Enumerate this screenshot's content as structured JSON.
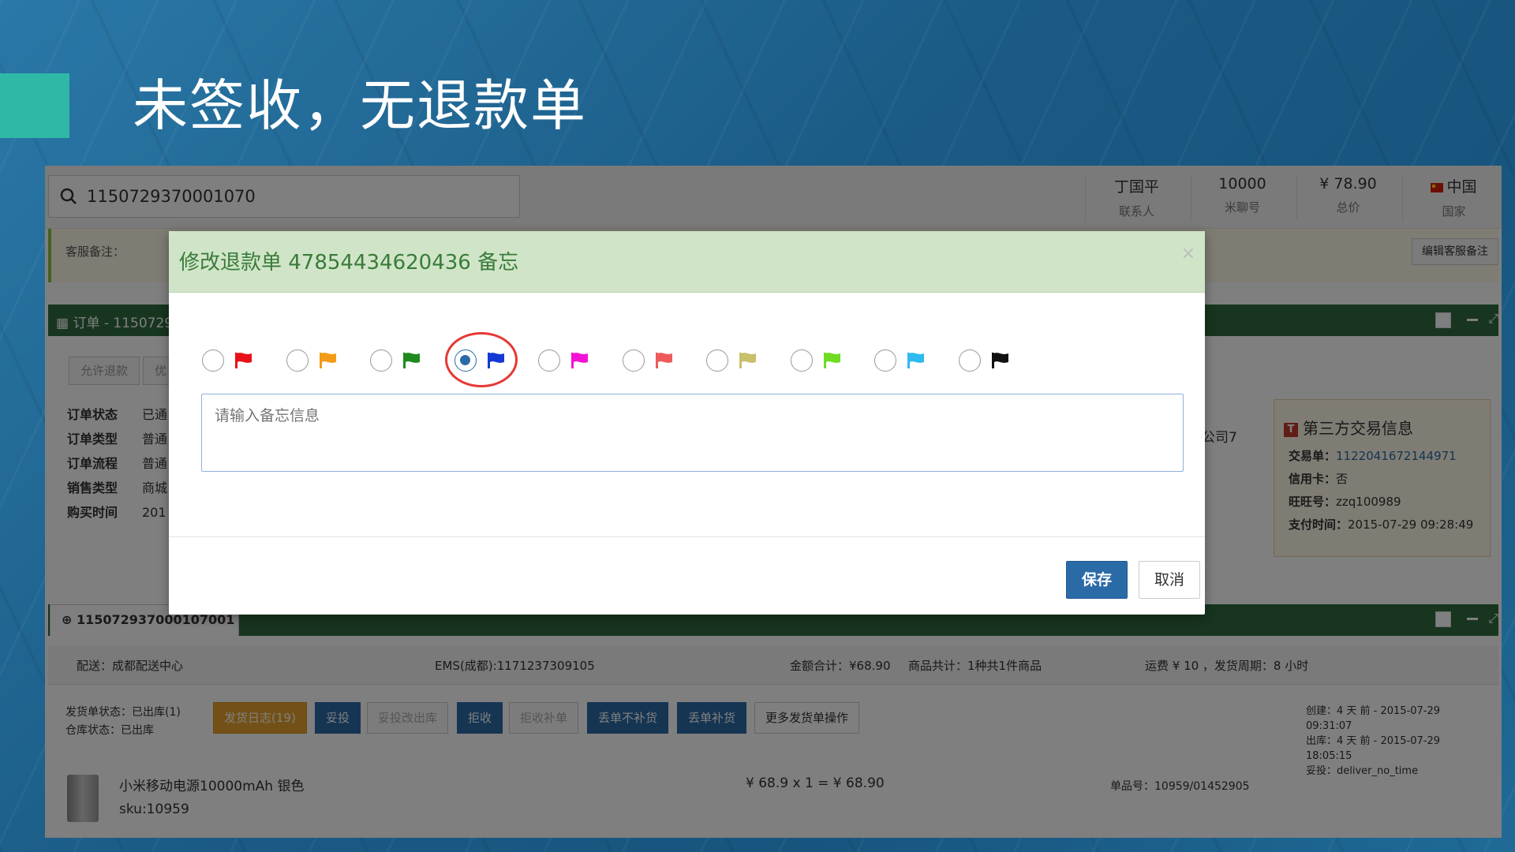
{
  "slide": {
    "title": "未签收，无退款单"
  },
  "app": {
    "search": {
      "value": "1150729370001070"
    },
    "stats": [
      {
        "value": "丁国平",
        "label": "联系人"
      },
      {
        "value": "10000",
        "label": "米聊号"
      },
      {
        "value": "¥ 78.90",
        "label": "总价"
      },
      {
        "value": "中国",
        "label": "国家"
      }
    ],
    "note_label": "客服备注：",
    "edit_note_button": "编辑客服备注",
    "order_panel_title": "订单 - 1150729",
    "buttons": {
      "allow_refund": "允许退款",
      "other": "优"
    },
    "order_info": [
      {
        "label": "订单状态",
        "value": "已通"
      },
      {
        "label": "订单类型",
        "value": "普通"
      },
      {
        "label": "订单流程",
        "value": "普通"
      },
      {
        "label": "销售类型",
        "value": "商城"
      },
      {
        "label": "购买时间",
        "value": "201"
      }
    ],
    "company_text": "公司7",
    "third_party": {
      "title": "第三方交易信息",
      "icon_letter": "T",
      "trade_label": "交易单：",
      "trade_value": "1122041672144971",
      "credit_label": "信用卡：",
      "credit_value": "否",
      "wangwang_label": "旺旺号：",
      "wangwang_value": "zzq100989",
      "pay_label": "支付时间：",
      "pay_value": "2015-07-29 09:28:49"
    },
    "shipment_tab": "115072937000107001",
    "ship_bar": {
      "delivery": "配送：成都配送中心",
      "ems": "EMS(成都):1171237309105",
      "amount": "金额合计：¥68.90",
      "goods": "商品共计：1种共1件商品",
      "freight": "运费 ¥ 10 ，发货周期：8 小时"
    },
    "ship_status": {
      "line1": "发货单状态：已出库(1)",
      "line2": "仓库状态：已出库"
    },
    "ops": [
      "发货日志(19)",
      "妥投",
      "妥投改出库",
      "拒收",
      "拒收补单",
      "丢单不补货",
      "丢单补货",
      "更多发货单操作"
    ],
    "times": {
      "created": "创建：4 天 前 - 2015-07-29 09:31:07",
      "outbound": "出库：4 天 前 - 2015-07-29 18:05:15",
      "delivered": "妥投：deliver_no_time"
    },
    "product": {
      "name": "小米移动电源10000mAh 银色",
      "sku": "sku:10959",
      "price": "¥ 68.9 x 1 = ¥ 68.90",
      "item_no": "单品号：10959/01452905"
    }
  },
  "modal": {
    "title": "修改退款单 47854434620436 备忘",
    "close": "×",
    "flag_colors": [
      "#e8111a",
      "#f39b16",
      "#1e8a1e",
      "#1438d6",
      "#f312d6",
      "#ee5a5a",
      "#c8c06a",
      "#6fdc23",
      "#2ebaf0",
      "#111111"
    ],
    "selected_index": 3,
    "memo_placeholder": "请输入备忘信息",
    "save": "保存",
    "cancel": "取消"
  }
}
